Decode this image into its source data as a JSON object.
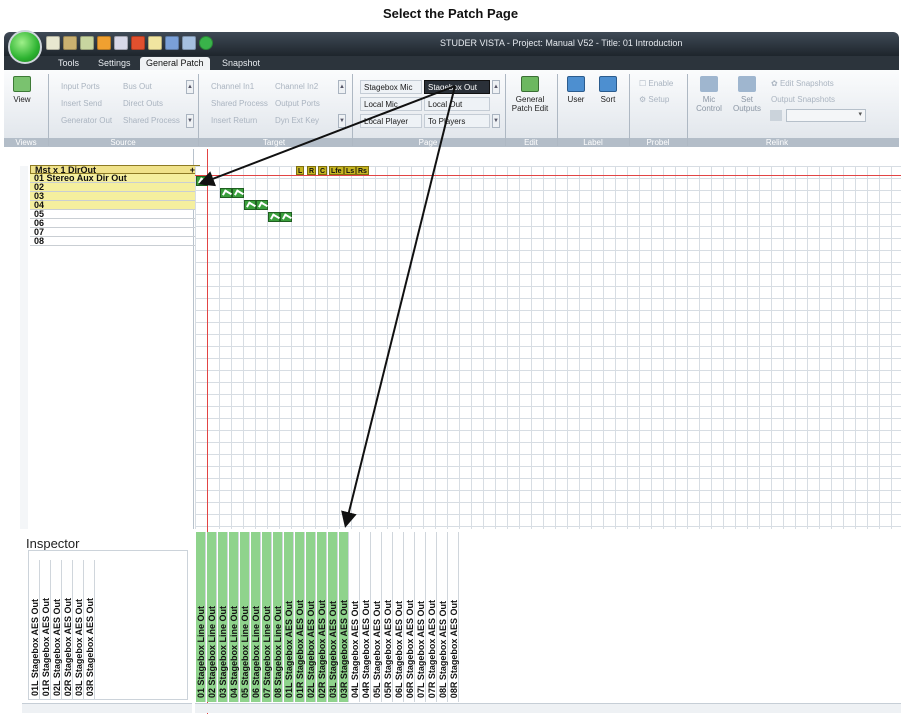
{
  "caption": "Select the Patch Page",
  "window_title": "STUDER VISTA - Project: Manual V52 - Title: 01 Introduction",
  "tabs": [
    "Tools",
    "Settings",
    "General Patch",
    "Snapshot"
  ],
  "views": {
    "view": "View",
    "group": "Views"
  },
  "source": {
    "group": "Source",
    "items": [
      "Input Ports",
      "Bus Out",
      "Insert Send",
      "Direct Outs",
      "Generator Out",
      "Shared Process"
    ]
  },
  "target": {
    "group": "Target",
    "items": [
      "Channel In1",
      "Channel In2",
      "Shared Process",
      "Output Ports",
      "Insert Return",
      "Dyn Ext Key"
    ]
  },
  "page": {
    "group": "Page",
    "items": [
      "Stagebox Mic",
      "Stagebox Out",
      "Local Mic",
      "Local Out",
      "Local Player",
      "To Players"
    ],
    "selected": "Stagebox Out"
  },
  "edit": {
    "group": "Edit",
    "general": "General",
    "patch_edit": "Patch Edit"
  },
  "label": {
    "group": "Label",
    "user": "User",
    "sort": "Sort"
  },
  "probel": {
    "group": "Probel",
    "enable": "Enable",
    "setup": "Setup"
  },
  "relink": {
    "group": "Relink",
    "mic": "Mic",
    "control": "Control",
    "set": "Set",
    "outputs": "Outputs",
    "edit_snapshots": "Edit Snapshots",
    "output_snapshots": "Output Snapshots"
  },
  "rows": {
    "header": "Mst x  1 DirOut",
    "items": [
      "01 Stereo Aux Dir Out",
      "02",
      "03",
      "04",
      "05",
      "06",
      "07",
      "08"
    ]
  },
  "header_labels": [
    "L",
    "R",
    "C",
    "Lfe",
    "Ls",
    "Rs"
  ],
  "inspector": {
    "title": "Inspector",
    "columns": [
      "01L Stagebox AES Out",
      "01R Stagebox AES Out",
      "02L Stagebox AES Out",
      "02R Stagebox AES Out",
      "03L Stagebox AES Out",
      "03R Stagebox AES Out"
    ]
  },
  "columns": [
    "01 Stagebox Line Out",
    "02 Stagebox Line Out",
    "03 Stagebox Line Out",
    "04 Stagebox Line Out",
    "05 Stagebox Line Out",
    "06 Stagebox Line Out",
    "07 Stagebox Line Out",
    "08 Stagebox Line Out",
    "01L Stagebox AES Out",
    "01R Stagebox AES Out",
    "02L Stagebox AES Out",
    "02R Stagebox AES Out",
    "03L Stagebox AES Out",
    "03R Stagebox AES Out",
    "04L Stagebox AES Out",
    "04R Stagebox AES Out",
    "05L Stagebox AES Out",
    "05R Stagebox AES Out",
    "06L Stagebox AES Out",
    "06R Stagebox AES Out",
    "07L Stagebox AES Out",
    "07R Stagebox AES Out",
    "08L Stagebox AES Out",
    "08R Stagebox AES Out"
  ],
  "colors": {
    "patch_green": "#3a9f3c",
    "column_green": "#8fd38c",
    "red_line": "#e24444",
    "row_yellow": "#f5ef9e"
  }
}
